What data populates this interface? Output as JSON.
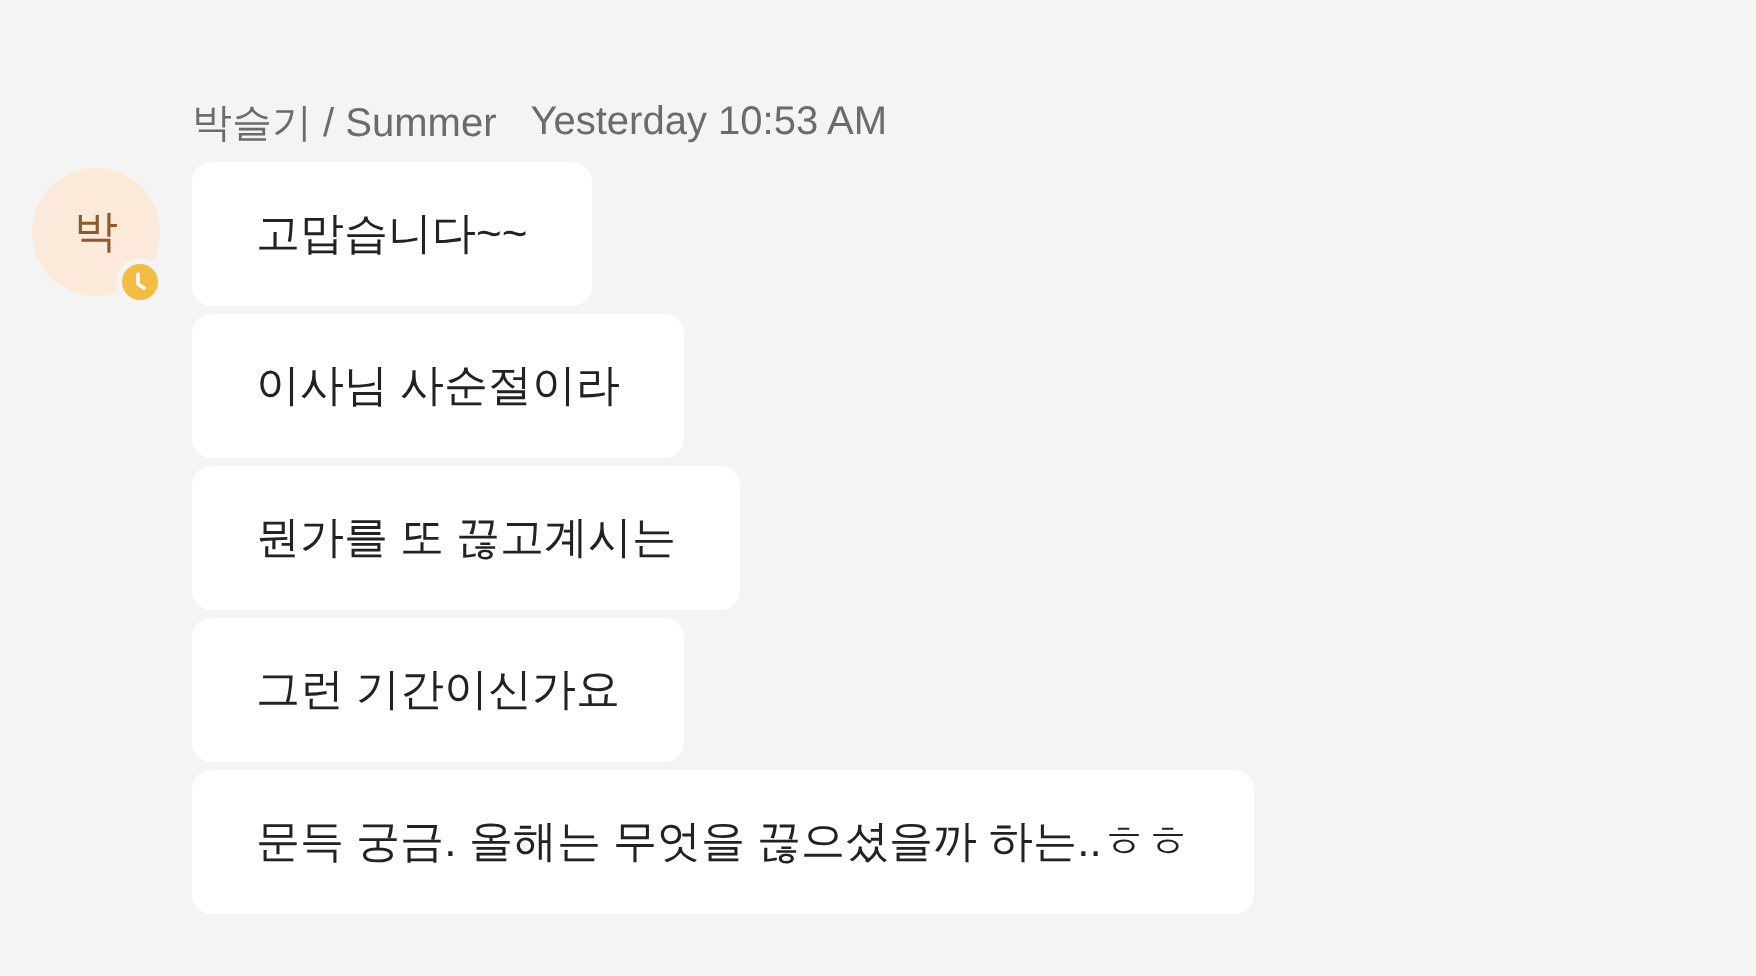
{
  "message_group": {
    "avatar": {
      "initial": "박",
      "away": true
    },
    "sender": "박슬기 / Summer",
    "time": "Yesterday 10:53 AM",
    "messages": [
      {
        "text": "고맙습니다~~"
      },
      {
        "text": "이사님 사순절이라"
      },
      {
        "text": "뭔가를 또 끊고계시는"
      },
      {
        "text": "그런 기간이신가요"
      },
      {
        "text": "문득 궁금. 올해는 무엇을 끊으셨을까 하는..ㅎㅎ"
      }
    ]
  }
}
